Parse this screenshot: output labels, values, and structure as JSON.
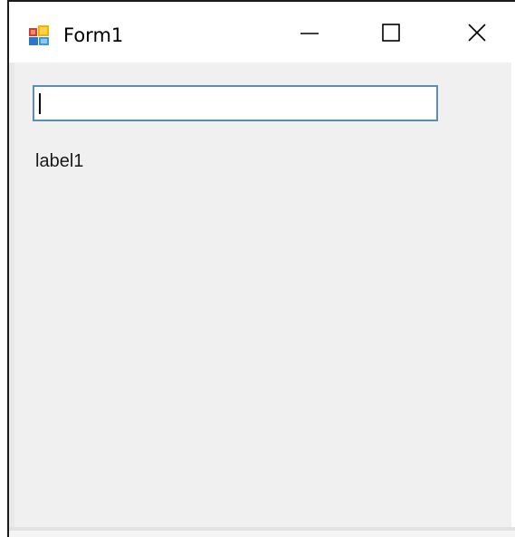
{
  "window": {
    "title": "Form1",
    "icons": {
      "app": "winforms-app-icon",
      "minimize": "minimize-icon",
      "maximize": "maximize-icon",
      "close": "close-icon"
    }
  },
  "form": {
    "textbox": {
      "value": "",
      "placeholder": ""
    },
    "label": "label1"
  },
  "colors": {
    "client_background": "#f0f0f0",
    "titlebar_background": "#ffffff",
    "textbox_border": "#5a8fb0"
  }
}
